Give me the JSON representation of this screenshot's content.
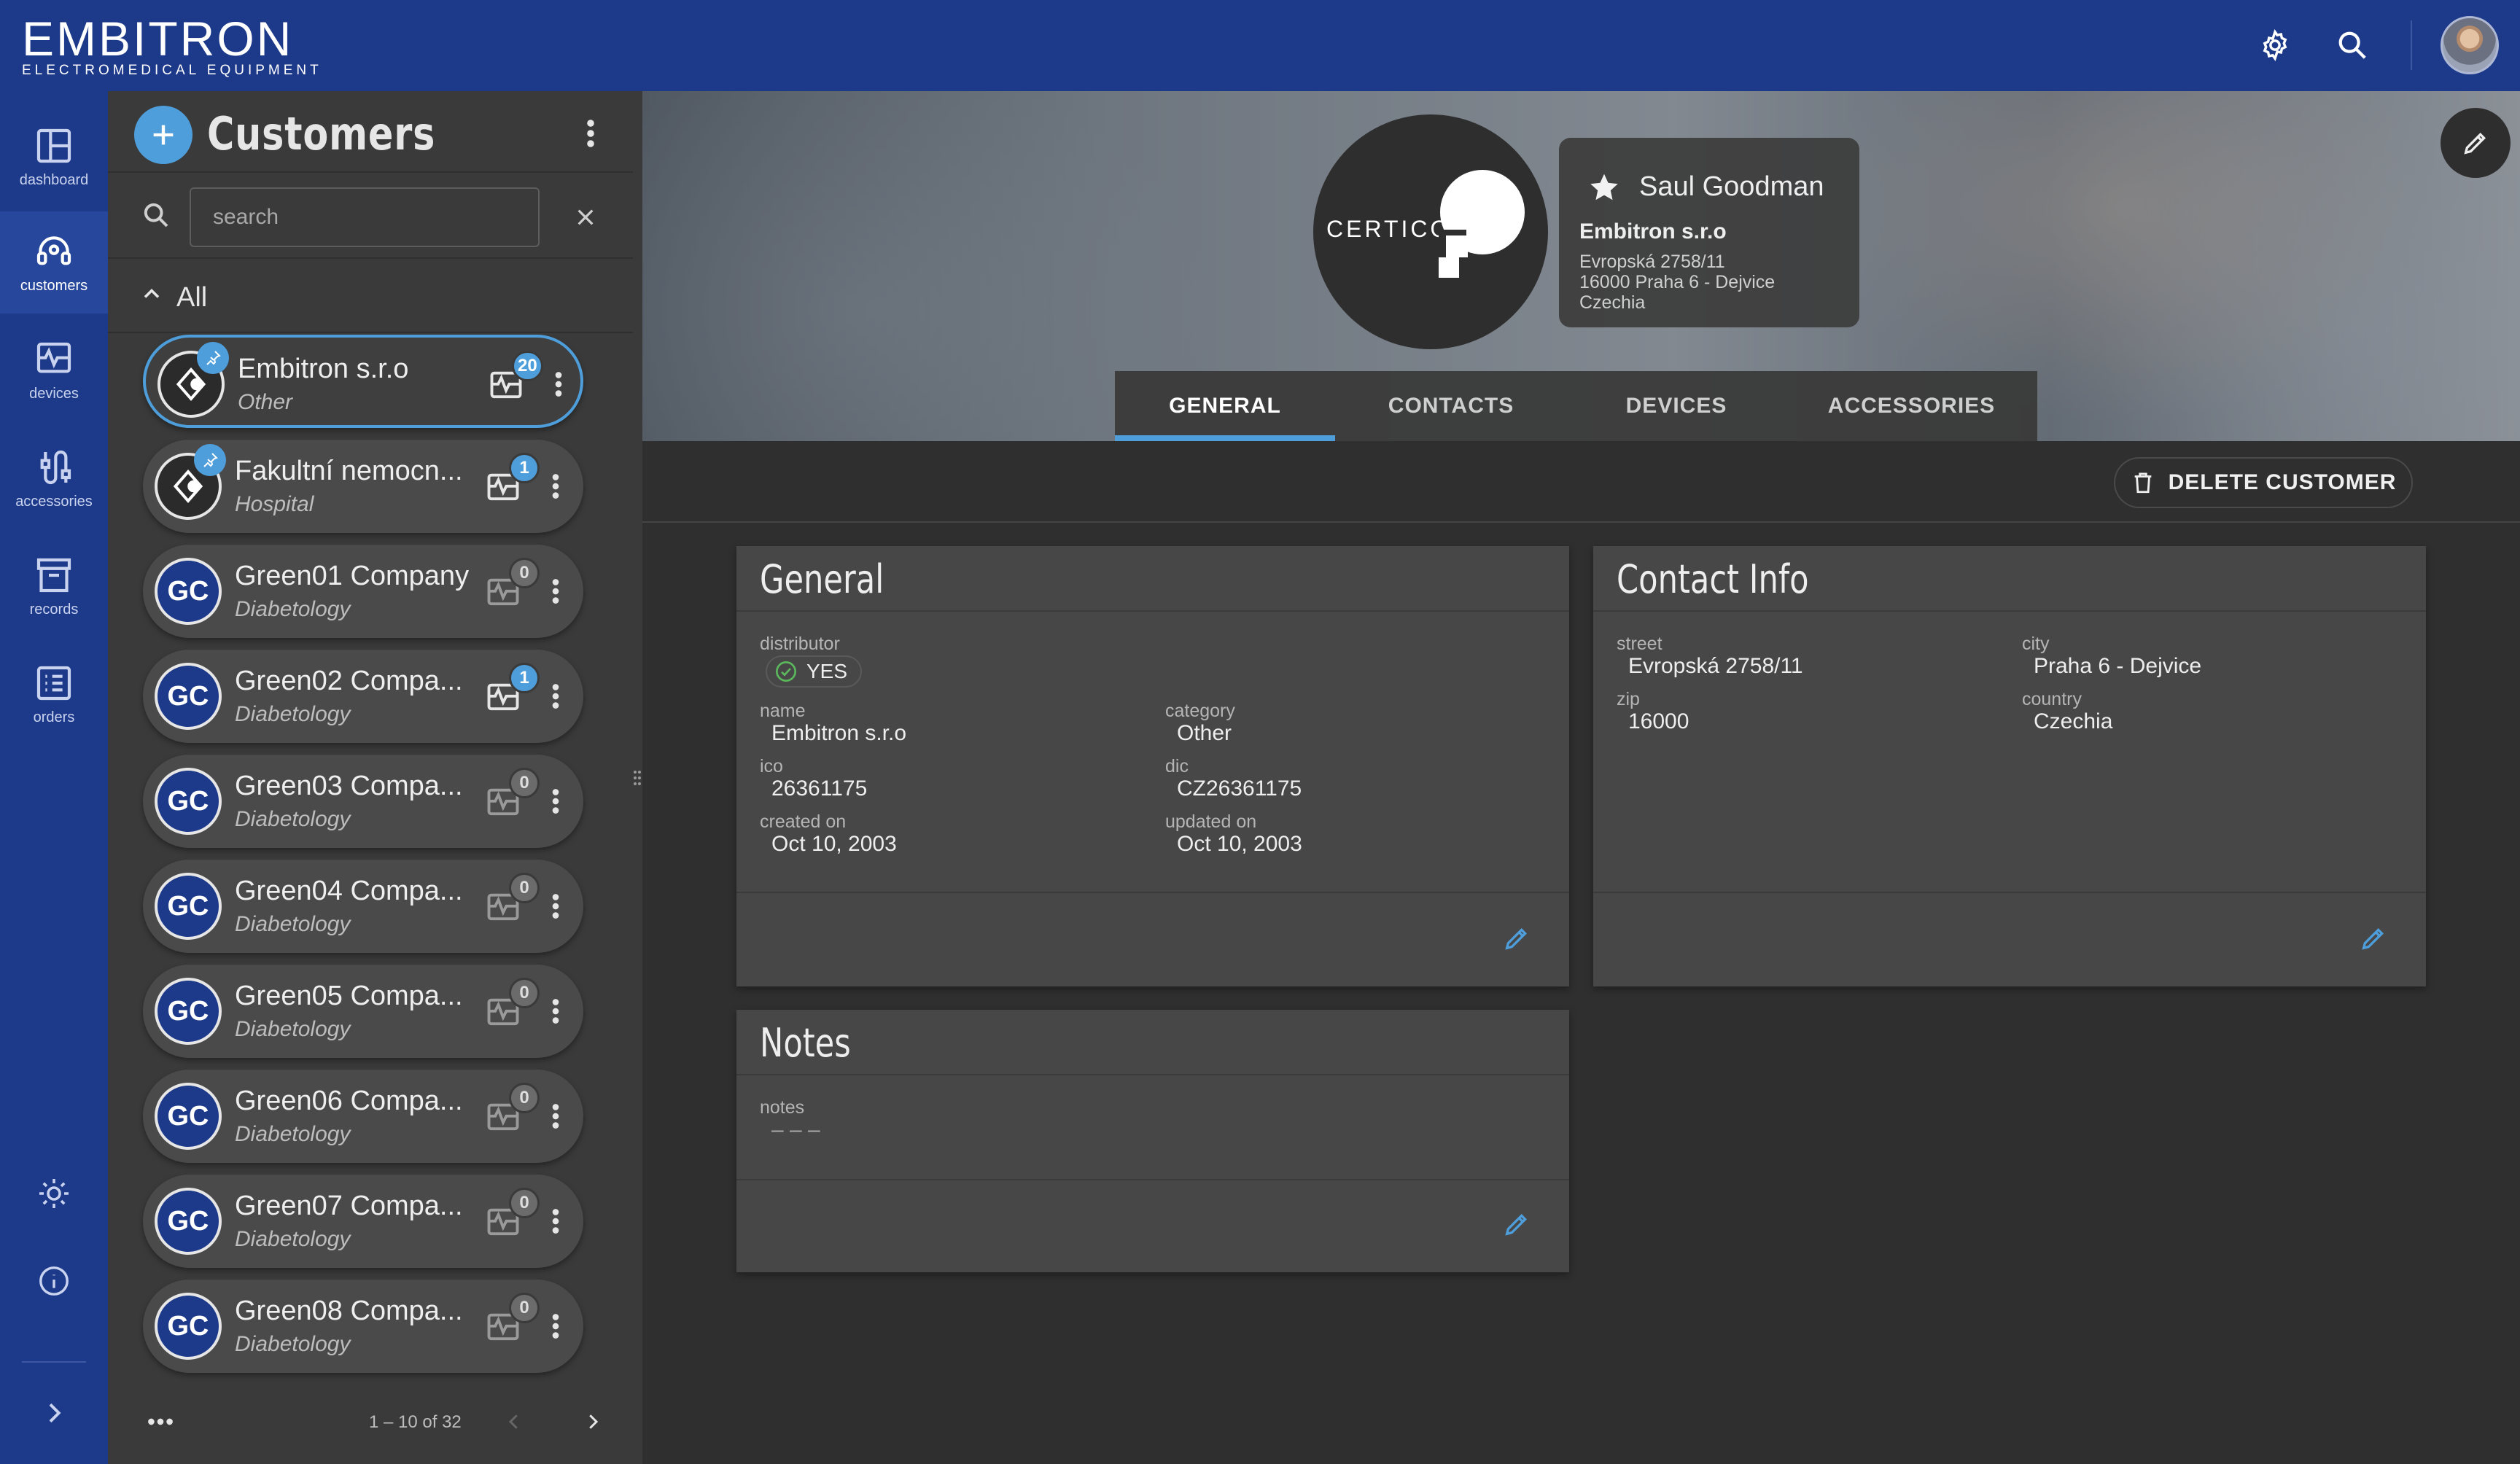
{
  "topbar": {
    "logo_main": "EMBITRON",
    "logo_sub": "ELECTROMEDICAL EQUIPMENT",
    "settings_icon": "gear-icon",
    "search_icon": "search-icon"
  },
  "rail": {
    "items": [
      {
        "label": "dashboard",
        "icon": "dashboard-icon"
      },
      {
        "label": "customers",
        "icon": "headset-icon"
      },
      {
        "label": "devices",
        "icon": "monitor-pulse-icon"
      },
      {
        "label": "accessories",
        "icon": "cable-icon"
      },
      {
        "label": "records",
        "icon": "archive-icon"
      },
      {
        "label": "orders",
        "icon": "list-icon"
      }
    ]
  },
  "list": {
    "title": "Customers",
    "search_placeholder": "search",
    "filter_label": "All",
    "pagination": "1 – 10 of 32",
    "customers": [
      {
        "name": "Embitron s.r.o",
        "category": "Other",
        "count": "20",
        "initials": "",
        "pinned": true,
        "selected": true
      },
      {
        "name": "Fakultní nemocn...",
        "category": "Hospital",
        "count": "1",
        "initials": "",
        "pinned": true,
        "selected": false
      },
      {
        "name": "Green01 Company",
        "category": "Diabetology",
        "count": "0",
        "initials": "GC"
      },
      {
        "name": "Green02 Compa...",
        "category": "Diabetology",
        "count": "1",
        "initials": "GC"
      },
      {
        "name": "Green03 Compa...",
        "category": "Diabetology",
        "count": "0",
        "initials": "GC"
      },
      {
        "name": "Green04 Compa...",
        "category": "Diabetology",
        "count": "0",
        "initials": "GC"
      },
      {
        "name": "Green05 Compa...",
        "category": "Diabetology",
        "count": "0",
        "initials": "GC"
      },
      {
        "name": "Green06 Compa...",
        "category": "Diabetology",
        "count": "0",
        "initials": "GC"
      },
      {
        "name": "Green07 Compa...",
        "category": "Diabetology",
        "count": "0",
        "initials": "GC"
      },
      {
        "name": "Green08 Compa...",
        "category": "Diabetology",
        "count": "0",
        "initials": "GC"
      }
    ]
  },
  "hero": {
    "logo_text": "CERTICON",
    "owner": "Saul Goodman",
    "company": "Embitron s.r.o",
    "address_line1": "Evropská 2758/11",
    "address_line2": "16000 Praha 6 - Dejvice",
    "address_line3": "Czechia"
  },
  "tabs": [
    "GENERAL",
    "CONTACTS",
    "DEVICES",
    "ACCESSORIES"
  ],
  "actions": {
    "delete_label": "DELETE CUSTOMER"
  },
  "general": {
    "title": "General",
    "distributor_label": "distributor",
    "distributor_value": "YES",
    "name_label": "name",
    "name_value": "Embitron s.r.o",
    "category_label": "category",
    "category_value": "Other",
    "ico_label": "ico",
    "ico_value": "26361175",
    "dic_label": "dic",
    "dic_value": "CZ26361175",
    "created_label": "created on",
    "created_value": "Oct 10, 2003",
    "updated_label": "updated on",
    "updated_value": "Oct 10, 2003"
  },
  "contact": {
    "title": "Contact Info",
    "street_label": "street",
    "street_value": "Evropská 2758/11",
    "city_label": "city",
    "city_value": "Praha 6 - Dejvice",
    "zip_label": "zip",
    "zip_value": "16000",
    "country_label": "country",
    "country_value": "Czechia"
  },
  "notes": {
    "title": "Notes",
    "notes_label": "notes",
    "notes_value": "– – –"
  },
  "colors": {
    "brand": "#1d3a8a",
    "accent": "#4e9edb",
    "panel": "#3a3a3a",
    "card": "#474747",
    "success": "#5cb85c"
  }
}
